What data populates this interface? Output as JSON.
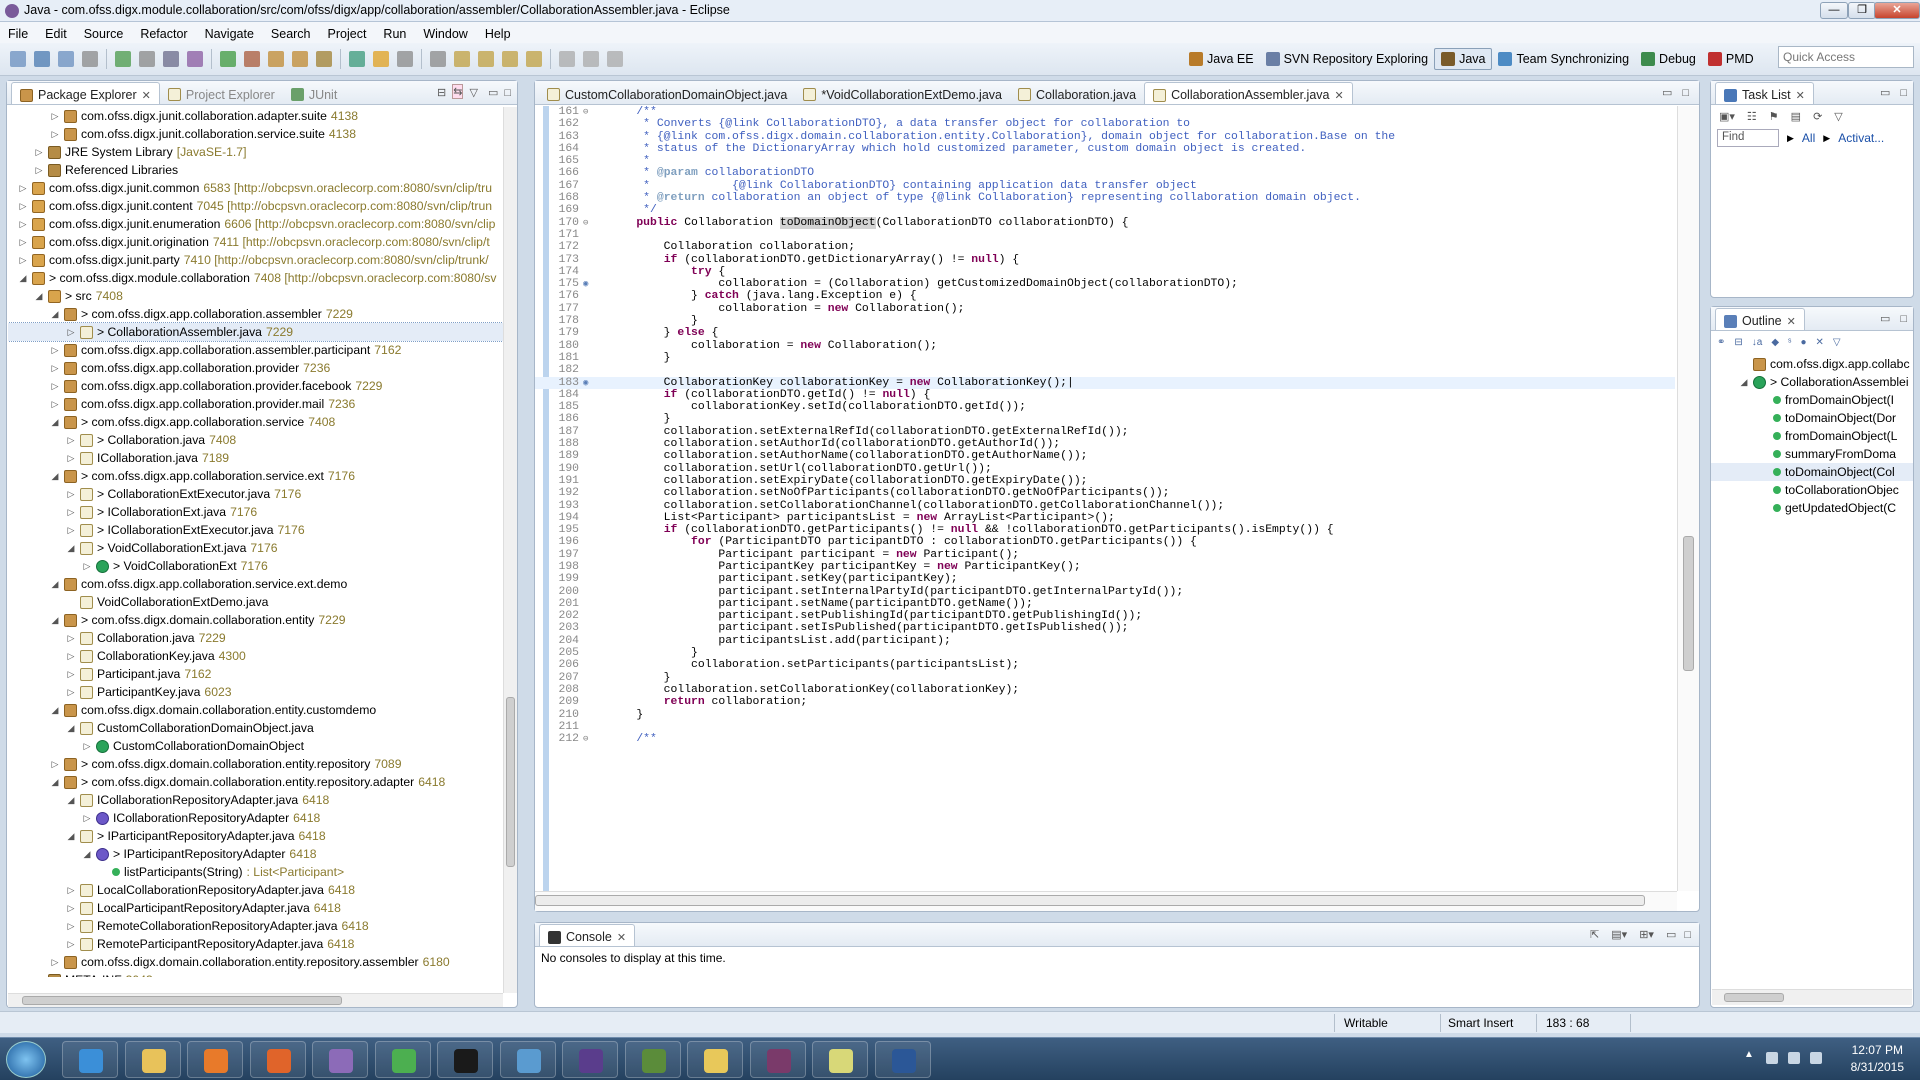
{
  "window": {
    "title": "Java - com.ofss.digx.module.collaboration/src/com/ofss/digx/app/collaboration/assembler/CollaborationAssembler.java - Eclipse",
    "min": "—",
    "max": "❐",
    "close": "✕"
  },
  "menu": [
    "File",
    "Edit",
    "Source",
    "Refactor",
    "Navigate",
    "Search",
    "Project",
    "Run",
    "Window",
    "Help"
  ],
  "perspectives": [
    {
      "label": "Java EE",
      "icon": "java-ee-perspective-icon",
      "color": "#b87b2a",
      "active": false
    },
    {
      "label": "SVN Repository Exploring",
      "icon": "svn-perspective-icon",
      "color": "#6a7fa5",
      "active": false
    },
    {
      "label": "Java",
      "icon": "java-perspective-icon",
      "color": "#7a5b2a",
      "active": true
    },
    {
      "label": "Team Synchronizing",
      "icon": "team-sync-perspective-icon",
      "color": "#4d8bc4",
      "active": false
    },
    {
      "label": "Debug",
      "icon": "debug-perspective-icon",
      "color": "#3d8b4d",
      "active": false
    },
    {
      "label": "PMD",
      "icon": "pmd-perspective-icon",
      "color": "#c03030",
      "active": false
    }
  ],
  "quick_access": {
    "placeholder": "Quick Access"
  },
  "package_explorer": {
    "tabs": [
      "Package Explorer",
      "Project Explorer",
      "JUnit"
    ],
    "tree": [
      {
        "indent": 3,
        "tog": "▷",
        "icon": "pkg",
        "label": "com.ofss.digx.junit.collaboration.adapter.suite",
        "rev": " 4138"
      },
      {
        "indent": 3,
        "tog": "▷",
        "icon": "pkg",
        "label": "com.ofss.digx.junit.collaboration.service.suite",
        "rev": " 4138"
      },
      {
        "indent": 2,
        "tog": "▷",
        "icon": "lib",
        "label": "JRE System Library",
        "rev": " [JavaSE-1.7]"
      },
      {
        "indent": 2,
        "tog": "▷",
        "icon": "lib",
        "label": "Referenced Libraries",
        "rev": ""
      },
      {
        "indent": 1,
        "tog": "▷",
        "icon": "proj",
        "label": "com.ofss.digx.junit.common",
        "rev": " 6583 [http://obcpsvn.oraclecorp.com:8080/svn/clip/tru"
      },
      {
        "indent": 1,
        "tog": "▷",
        "icon": "proj",
        "label": "com.ofss.digx.junit.content",
        "rev": " 7045 [http://obcpsvn.oraclecorp.com:8080/svn/clip/trun"
      },
      {
        "indent": 1,
        "tog": "▷",
        "icon": "proj",
        "label": "com.ofss.digx.junit.enumeration",
        "rev": " 6606 [http://obcpsvn.oraclecorp.com:8080/svn/clip"
      },
      {
        "indent": 1,
        "tog": "▷",
        "icon": "proj",
        "label": "com.ofss.digx.junit.origination",
        "rev": " 7411 [http://obcpsvn.oraclecorp.com:8080/svn/clip/t"
      },
      {
        "indent": 1,
        "tog": "▷",
        "icon": "proj",
        "label": "com.ofss.digx.junit.party",
        "rev": " 7410 [http://obcpsvn.oraclecorp.com:8080/svn/clip/trunk/"
      },
      {
        "indent": 1,
        "tog": "◢",
        "icon": "proj",
        "label": "> com.ofss.digx.module.collaboration",
        "rev": " 7408 [http://obcpsvn.oraclecorp.com:8080/sv"
      },
      {
        "indent": 2,
        "tog": "◢",
        "icon": "proj",
        "label": "> src",
        "rev": " 7408"
      },
      {
        "indent": 3,
        "tog": "◢",
        "icon": "pkg",
        "label": "> com.ofss.digx.app.collaboration.assembler",
        "rev": " 7229"
      },
      {
        "indent": 4,
        "tog": "▷",
        "icon": "jf",
        "label": "> CollaborationAssembler.java",
        "rev": " 7229",
        "sel": true
      },
      {
        "indent": 3,
        "tog": "▷",
        "icon": "pkg",
        "label": "com.ofss.digx.app.collaboration.assembler.participant",
        "rev": " 7162"
      },
      {
        "indent": 3,
        "tog": "▷",
        "icon": "pkg",
        "label": "com.ofss.digx.app.collaboration.provider",
        "rev": " 7236"
      },
      {
        "indent": 3,
        "tog": "▷",
        "icon": "pkg",
        "label": "com.ofss.digx.app.collaboration.provider.facebook",
        "rev": " 7229"
      },
      {
        "indent": 3,
        "tog": "▷",
        "icon": "pkg",
        "label": "com.ofss.digx.app.collaboration.provider.mail",
        "rev": " 7236"
      },
      {
        "indent": 3,
        "tog": "◢",
        "icon": "pkg",
        "label": "> com.ofss.digx.app.collaboration.service",
        "rev": " 7408"
      },
      {
        "indent": 4,
        "tog": "▷",
        "icon": "jf",
        "label": "> Collaboration.java",
        "rev": " 7408"
      },
      {
        "indent": 4,
        "tog": "▷",
        "icon": "jf",
        "label": "ICollaboration.java",
        "rev": " 7189"
      },
      {
        "indent": 3,
        "tog": "◢",
        "icon": "pkg",
        "label": "> com.ofss.digx.app.collaboration.service.ext",
        "rev": " 7176"
      },
      {
        "indent": 4,
        "tog": "▷",
        "icon": "jf",
        "label": "> CollaborationExtExecutor.java",
        "rev": " 7176"
      },
      {
        "indent": 4,
        "tog": "▷",
        "icon": "jf",
        "label": "> ICollaborationExt.java",
        "rev": " 7176"
      },
      {
        "indent": 4,
        "tog": "▷",
        "icon": "jf",
        "label": "> ICollaborationExtExecutor.java",
        "rev": " 7176"
      },
      {
        "indent": 4,
        "tog": "◢",
        "icon": "jf",
        "label": "> VoidCollaborationExt.java",
        "rev": " 7176"
      },
      {
        "indent": 5,
        "tog": "▷",
        "icon": "cls",
        "label": "> VoidCollaborationExt",
        "rev": " 7176"
      },
      {
        "indent": 3,
        "tog": "◢",
        "icon": "pkg",
        "label": "com.ofss.digx.app.collaboration.service.ext.demo",
        "rev": ""
      },
      {
        "indent": 4,
        "tog": "",
        "icon": "jf",
        "label": "VoidCollaborationExtDemo.java",
        "rev": ""
      },
      {
        "indent": 3,
        "tog": "◢",
        "icon": "pkg",
        "label": "> com.ofss.digx.domain.collaboration.entity",
        "rev": " 7229"
      },
      {
        "indent": 4,
        "tog": "▷",
        "icon": "jf",
        "label": "Collaboration.java",
        "rev": " 7229"
      },
      {
        "indent": 4,
        "tog": "▷",
        "icon": "jf",
        "label": "CollaborationKey.java",
        "rev": " 4300"
      },
      {
        "indent": 4,
        "tog": "▷",
        "icon": "jf",
        "label": "Participant.java",
        "rev": " 7162"
      },
      {
        "indent": 4,
        "tog": "▷",
        "icon": "jf",
        "label": "ParticipantKey.java",
        "rev": " 6023"
      },
      {
        "indent": 3,
        "tog": "◢",
        "icon": "pkg",
        "label": "com.ofss.digx.domain.collaboration.entity.customdemo",
        "rev": ""
      },
      {
        "indent": 4,
        "tog": "◢",
        "icon": "jf",
        "label": "CustomCollaborationDomainObject.java",
        "rev": ""
      },
      {
        "indent": 5,
        "tog": "▷",
        "icon": "cls",
        "label": "CustomCollaborationDomainObject",
        "rev": ""
      },
      {
        "indent": 3,
        "tog": "▷",
        "icon": "pkg",
        "label": "> com.ofss.digx.domain.collaboration.entity.repository",
        "rev": " 7089"
      },
      {
        "indent": 3,
        "tog": "◢",
        "icon": "pkg",
        "label": "> com.ofss.digx.domain.collaboration.entity.repository.adapter",
        "rev": " 6418"
      },
      {
        "indent": 4,
        "tog": "◢",
        "icon": "jf",
        "label": "ICollaborationRepositoryAdapter.java",
        "rev": " 6418"
      },
      {
        "indent": 5,
        "tog": "▷",
        "icon": "itf",
        "label": "ICollaborationRepositoryAdapter",
        "rev": " 6418"
      },
      {
        "indent": 4,
        "tog": "◢",
        "icon": "jf",
        "label": "> IParticipantRepositoryAdapter.java",
        "rev": " 6418"
      },
      {
        "indent": 5,
        "tog": "◢",
        "icon": "itf",
        "label": "> IParticipantRepositoryAdapter",
        "rev": " 6418"
      },
      {
        "indent": 6,
        "tog": "",
        "icon": "meth",
        "label": "listParticipants(String)",
        "rev": " : List<Participant>"
      },
      {
        "indent": 4,
        "tog": "▷",
        "icon": "jf",
        "label": "LocalCollaborationRepositoryAdapter.java",
        "rev": " 6418"
      },
      {
        "indent": 4,
        "tog": "▷",
        "icon": "jf",
        "label": "LocalParticipantRepositoryAdapter.java",
        "rev": " 6418"
      },
      {
        "indent": 4,
        "tog": "▷",
        "icon": "jf",
        "label": "RemoteCollaborationRepositoryAdapter.java",
        "rev": " 6418"
      },
      {
        "indent": 4,
        "tog": "▷",
        "icon": "jf",
        "label": "RemoteParticipantRepositoryAdapter.java",
        "rev": " 6418"
      },
      {
        "indent": 3,
        "tog": "▷",
        "icon": "pkg",
        "label": "com.ofss.digx.domain.collaboration.entity.repository.assembler",
        "rev": " 6180"
      },
      {
        "indent": 2,
        "tog": "▷",
        "icon": "lib",
        "label": "META-INF",
        "rev": " 3043"
      }
    ]
  },
  "editor": {
    "tabs": [
      {
        "label": "CustomCollaborationDomainObject.java",
        "active": false,
        "close": false
      },
      {
        "label": "*VoidCollaborationExtDemo.java",
        "active": false,
        "close": false
      },
      {
        "label": "Collaboration.java",
        "active": false,
        "close": false
      },
      {
        "label": "CollaborationAssembler.java",
        "active": true,
        "close": true
      }
    ],
    "lines": [
      {
        "n": "161",
        "f": "⊖",
        "t": "    <jd>/**</jd>"
      },
      {
        "n": "162",
        "t": "<jd>     * Converts {@link CollaborationDTO}, a data transfer object for collaboration to</jd>"
      },
      {
        "n": "163",
        "t": "<jd>     * {@link com.ofss.digx.domain.collaboration.entity.Collaboration}, domain object for collaboration.Base on the</jd>"
      },
      {
        "n": "164",
        "t": "<jd>     * status of the DictionaryArray which hold customized parameter, custom domain object is created.</jd>"
      },
      {
        "n": "165",
        "t": "<jd>     *</jd>"
      },
      {
        "n": "166",
        "t": "<jd>     * </jd><tg>@param</tg><jd> collaborationDTO</jd>"
      },
      {
        "n": "167",
        "t": "<jd>     *            {@link CollaborationDTO} containing application data transfer object</jd>"
      },
      {
        "n": "168",
        "t": "<jd>     * </jd><tg>@return</tg><jd> collaboration an object of type {@link Collaboration} representing collaboration domain object.</jd>"
      },
      {
        "n": "169",
        "t": "<jd>     */</jd>"
      },
      {
        "n": "170",
        "f": "⊖",
        "t": "    <kw>public</kw> Collaboration <hl>toDomainObject</hl>(CollaborationDTO collaborationDTO) {"
      },
      {
        "n": "171",
        "t": ""
      },
      {
        "n": "172",
        "t": "        Collaboration collaboration;"
      },
      {
        "n": "173",
        "t": "        <kw>if</kw> (collaborationDTO.getDictionaryArray() != <kw>null</kw>) {"
      },
      {
        "n": "174",
        "t": "            <kw>try</kw> {"
      },
      {
        "n": "175",
        "m": true,
        "t": "                collaboration = (Collaboration) getCustomizedDomainObject(collaborationDTO);"
      },
      {
        "n": "176",
        "t": "            } <kw>catch</kw> (java.lang.Exception e) {"
      },
      {
        "n": "177",
        "t": "                collaboration = <kw>new</kw> Collaboration();"
      },
      {
        "n": "178",
        "t": "            }"
      },
      {
        "n": "179",
        "t": "        } <kw>else</kw> {"
      },
      {
        "n": "180",
        "t": "            collaboration = <kw>new</kw> Collaboration();"
      },
      {
        "n": "181",
        "t": "        }"
      },
      {
        "n": "182",
        "t": ""
      },
      {
        "n": "183",
        "m": true,
        "cur": true,
        "t": "        CollaborationKey collaborationKey = <kw>new</kw> CollaborationKey();|"
      },
      {
        "n": "184",
        "t": "        <kw>if</kw> (collaborationDTO.getId() != <kw>null</kw>) {"
      },
      {
        "n": "185",
        "t": "            collaborationKey.setId(collaborationDTO.getId());"
      },
      {
        "n": "186",
        "t": "        }"
      },
      {
        "n": "187",
        "t": "        collaboration.setExternalRefId(collaborationDTO.getExternalRefId());"
      },
      {
        "n": "188",
        "t": "        collaboration.setAuthorId(collaborationDTO.getAuthorId());"
      },
      {
        "n": "189",
        "t": "        collaboration.setAuthorName(collaborationDTO.getAuthorName());"
      },
      {
        "n": "190",
        "t": "        collaboration.setUrl(collaborationDTO.getUrl());"
      },
      {
        "n": "191",
        "t": "        collaboration.setExpiryDate(collaborationDTO.getExpiryDate());"
      },
      {
        "n": "192",
        "t": "        collaboration.setNoOfParticipants(collaborationDTO.getNoOfParticipants());"
      },
      {
        "n": "193",
        "t": "        collaboration.setCollaborationChannel(collaborationDTO.getCollaborationChannel());"
      },
      {
        "n": "194",
        "t": "        List&lt;Participant&gt; participantsList = <kw>new</kw> ArrayList&lt;Participant&gt;();"
      },
      {
        "n": "195",
        "t": "        <kw>if</kw> (collaborationDTO.getParticipants() != <kw>null</kw> &amp;&amp; !collaborationDTO.getParticipants().isEmpty()) {"
      },
      {
        "n": "196",
        "t": "            <kw>for</kw> (ParticipantDTO participantDTO : collaborationDTO.getParticipants()) {"
      },
      {
        "n": "197",
        "t": "                Participant participant = <kw>new</kw> Participant();"
      },
      {
        "n": "198",
        "t": "                ParticipantKey participantKey = <kw>new</kw> ParticipantKey();"
      },
      {
        "n": "199",
        "t": "                participant.setKey(participantKey);"
      },
      {
        "n": "200",
        "t": "                participant.setInternalPartyId(participantDTO.getInternalPartyId());"
      },
      {
        "n": "201",
        "t": "                participant.setName(participantDTO.getName());"
      },
      {
        "n": "202",
        "t": "                participant.setPublishingId(participantDTO.getPublishingId());"
      },
      {
        "n": "203",
        "t": "                participant.setIsPublished(participantDTO.getIsPublished());"
      },
      {
        "n": "204",
        "t": "                participantsList.add(participant);"
      },
      {
        "n": "205",
        "t": "            }"
      },
      {
        "n": "206",
        "t": "            collaboration.setParticipants(participantsList);"
      },
      {
        "n": "207",
        "t": "        }"
      },
      {
        "n": "208",
        "t": "        collaboration.setCollaborationKey(collaborationKey);"
      },
      {
        "n": "209",
        "t": "        <kw>return</kw> collaboration;"
      },
      {
        "n": "210",
        "t": "    }"
      },
      {
        "n": "211",
        "t": ""
      },
      {
        "n": "212",
        "f": "⊖",
        "t": "    <jd>/**</jd>"
      }
    ]
  },
  "console": {
    "tab": "Console",
    "message": "No consoles to display at this time."
  },
  "task_list": {
    "tab": "Task List",
    "find_placeholder": "Find",
    "all": "All",
    "activate": "Activat..."
  },
  "outline": {
    "tab": "Outline",
    "items": [
      {
        "indent": 1,
        "icon": "pkg",
        "label": "com.ofss.digx.app.collabc"
      },
      {
        "indent": 1,
        "icon": "cls",
        "label": "> CollaborationAssemblei",
        "tog": "◢"
      },
      {
        "indent": 2,
        "icon": "meth",
        "label": "fromDomainObject(I"
      },
      {
        "indent": 2,
        "icon": "meth",
        "label": "toDomainObject(Dor"
      },
      {
        "indent": 2,
        "icon": "meth",
        "label": "fromDomainObject(L"
      },
      {
        "indent": 2,
        "icon": "meth",
        "label": "summaryFromDoma"
      },
      {
        "indent": 2,
        "icon": "meth",
        "label": "toDomainObject(Col",
        "sel": true
      },
      {
        "indent": 2,
        "icon": "meth",
        "label": "toCollaborationObjec"
      },
      {
        "indent": 2,
        "icon": "meth",
        "label": "getUpdatedObject(C"
      }
    ]
  },
  "status": {
    "writable": "Writable",
    "insert": "Smart Insert",
    "position": "183 : 68"
  },
  "taskbar": {
    "apps": [
      {
        "name": "internet-explorer-icon",
        "color": "#3b8fd8"
      },
      {
        "name": "file-explorer-icon",
        "color": "#e8c25a"
      },
      {
        "name": "media-player-icon",
        "color": "#e87a2a"
      },
      {
        "name": "firefox-icon",
        "color": "#e0642a"
      },
      {
        "name": "pidgin-icon",
        "color": "#8c6bb8"
      },
      {
        "name": "chrome-icon",
        "color": "#4caf50"
      },
      {
        "name": "command-prompt-icon",
        "color": "#1a1a1a"
      },
      {
        "name": "remote-desktop-icon",
        "color": "#5a9bd0"
      },
      {
        "name": "eclipse-icon",
        "color": "#5a3d8c"
      },
      {
        "name": "winrar-icon",
        "color": "#5b8c3a"
      },
      {
        "name": "mail-icon",
        "color": "#e8c85a"
      },
      {
        "name": "java-ee-icon",
        "color": "#7a3a6a"
      },
      {
        "name": "notepad-icon",
        "color": "#d8d878"
      },
      {
        "name": "word-icon",
        "color": "#2b5797"
      }
    ],
    "time": "12:07 PM",
    "date": "8/31/2015"
  }
}
